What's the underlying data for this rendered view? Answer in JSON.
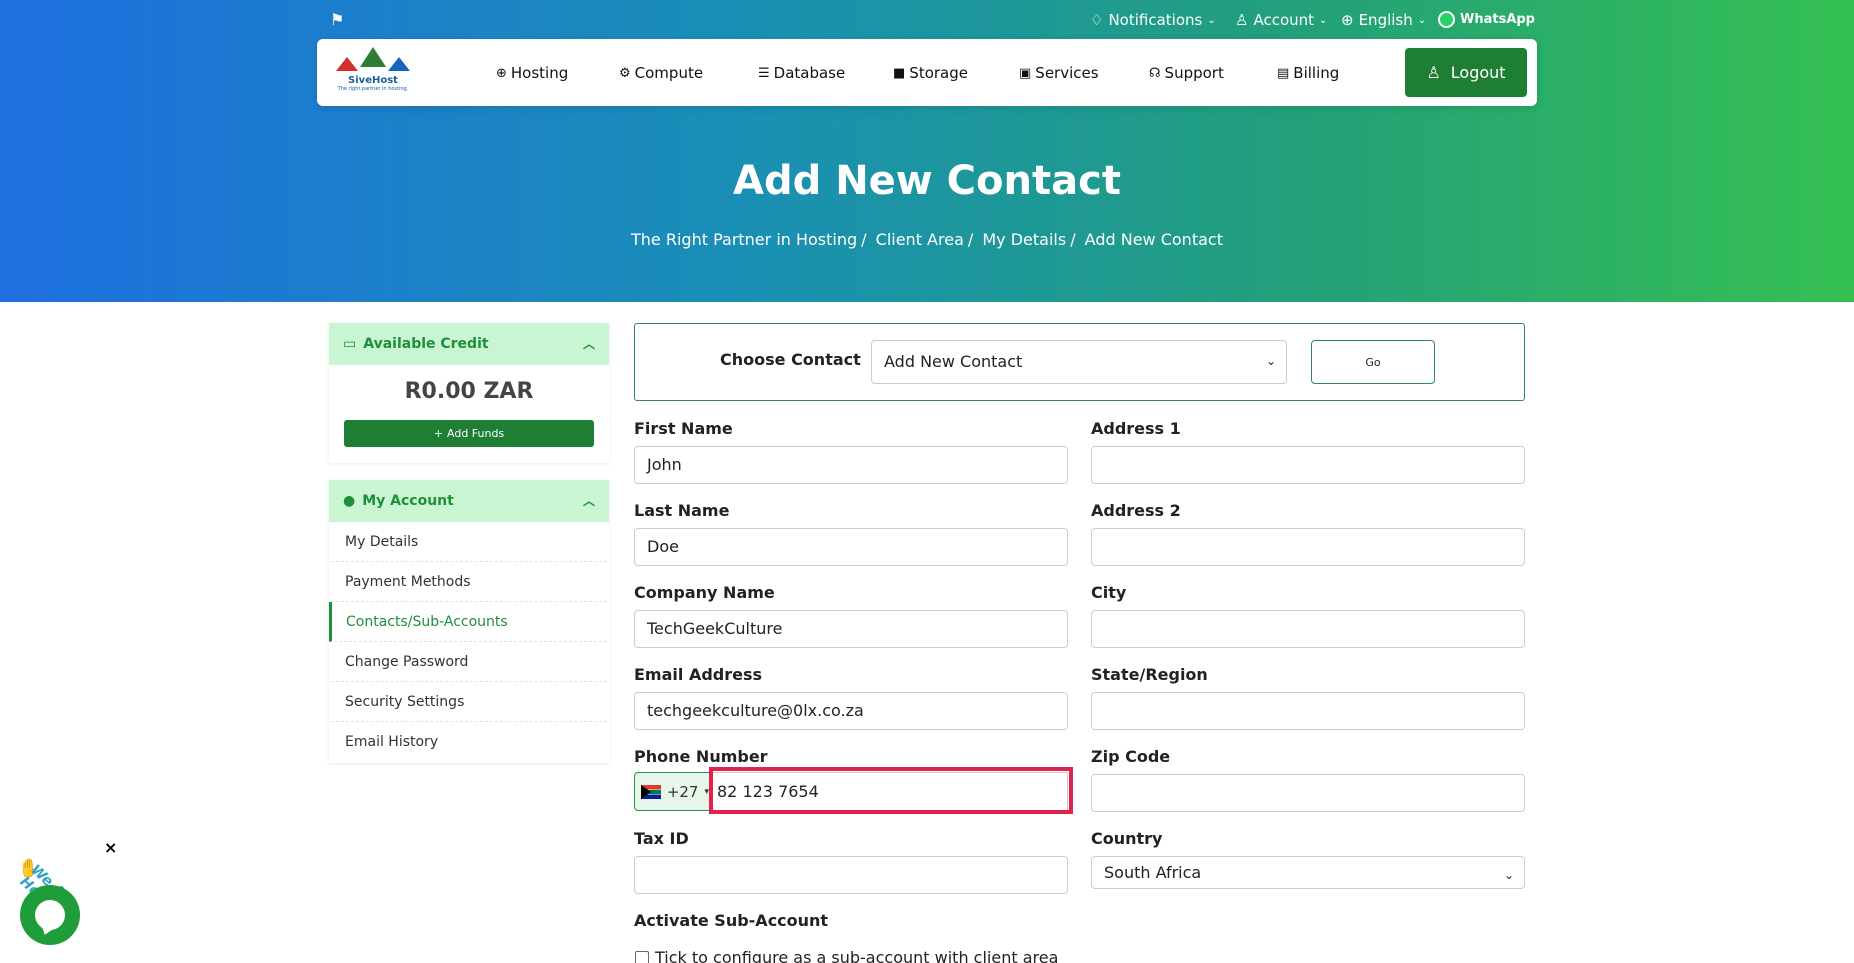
{
  "topbar": {
    "notifications": "Notifications",
    "account": "Account",
    "language": "English",
    "whatsapp": "WhatsApp"
  },
  "logo": {
    "brand": "SiveHost",
    "tagline": "The right partner in hosting."
  },
  "nav": {
    "items": [
      "Hosting",
      "Compute",
      "Database",
      "Storage",
      "Services",
      "Support",
      "Billing"
    ],
    "logout": "Logout"
  },
  "hero": {
    "title": "Add New Contact",
    "breadcrumb": [
      "The Right Partner in Hosting",
      "Client Area",
      "My Details",
      "Add New Contact"
    ]
  },
  "sidebar": {
    "credit": {
      "title": "Available Credit",
      "amount": "R0.00 ZAR",
      "add_funds": "Add Funds"
    },
    "account": {
      "title": "My Account",
      "items": [
        "My Details",
        "Payment Methods",
        "Contacts/Sub-Accounts",
        "Change Password",
        "Security Settings",
        "Email History"
      ],
      "active_index": 2
    }
  },
  "choose": {
    "label": "Choose Contact",
    "selected": "Add New Contact",
    "go": "Go"
  },
  "form": {
    "first_name": {
      "label": "First Name",
      "value": "John"
    },
    "last_name": {
      "label": "Last Name",
      "value": "Doe"
    },
    "company": {
      "label": "Company Name",
      "value": "TechGeekCulture"
    },
    "email": {
      "label": "Email Address",
      "value": "techgeekculture@0lx.co.za"
    },
    "phone": {
      "label": "Phone Number",
      "code": "+27",
      "value": "82 123 7654"
    },
    "tax_id": {
      "label": "Tax ID",
      "value": ""
    },
    "address1": {
      "label": "Address 1",
      "value": ""
    },
    "address2": {
      "label": "Address 2",
      "value": ""
    },
    "city": {
      "label": "City",
      "value": ""
    },
    "state": {
      "label": "State/Region",
      "value": ""
    },
    "zip": {
      "label": "Zip Code",
      "value": ""
    },
    "country": {
      "label": "Country",
      "value": "South Africa"
    },
    "activate": {
      "label": "Activate Sub-Account",
      "checkbox_label": "Tick to configure as a sub-account with client area"
    }
  },
  "chat": {
    "text": "We Are Here!",
    "close": "×"
  }
}
